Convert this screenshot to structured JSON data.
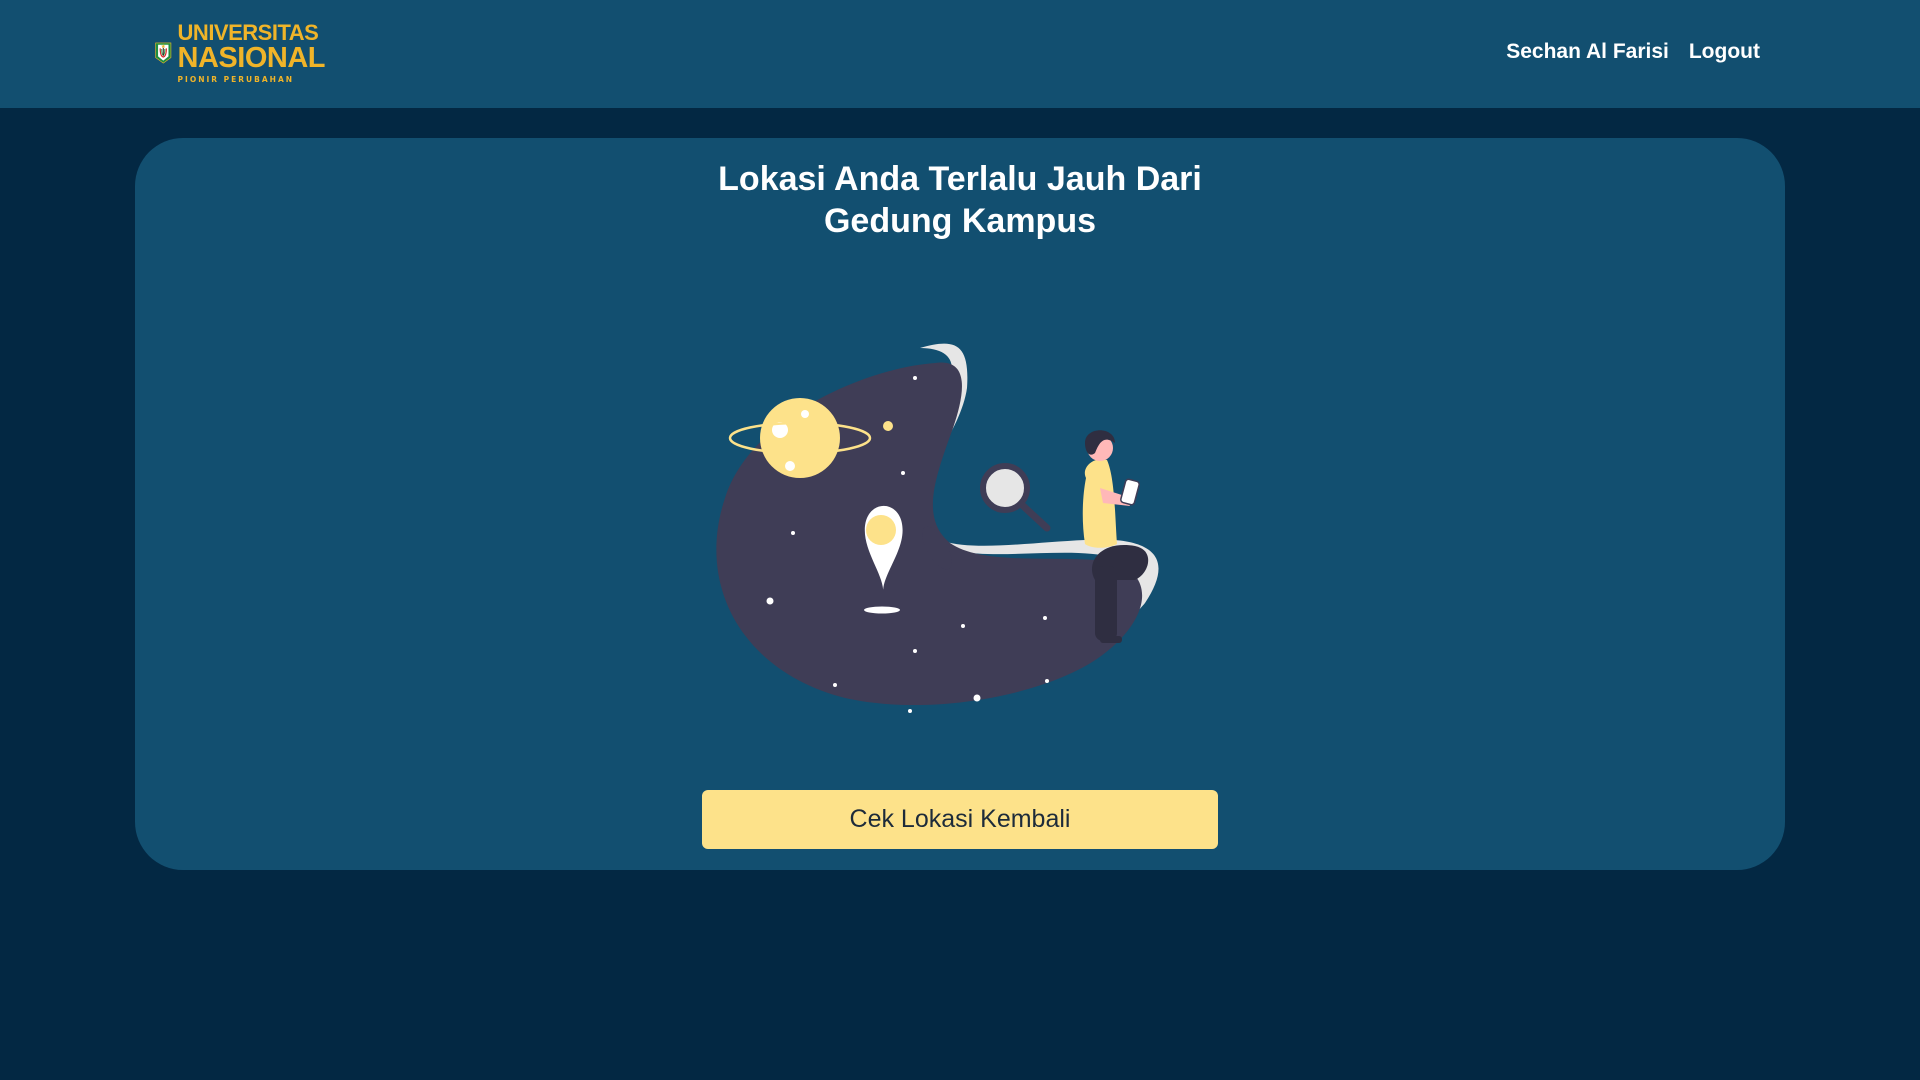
{
  "header": {
    "logo": {
      "line1": "UNIVERSITAS",
      "line2": "NASIONAL",
      "tagline": "PIONIR PERUBAHAN"
    },
    "user_name": "Sechan Al Farisi",
    "logout_label": "Logout"
  },
  "main": {
    "title_line1": "Lokasi Anda Terlalu Jauh Dari",
    "title_line2": "Gedung Kampus",
    "button_label": "Cek Lokasi Kembali"
  },
  "colors": {
    "background": "#032843",
    "panel": "#124F70",
    "accent_yellow": "#FDE28A",
    "logo_gold": "#F0B429",
    "blob": "#3F3D56"
  }
}
